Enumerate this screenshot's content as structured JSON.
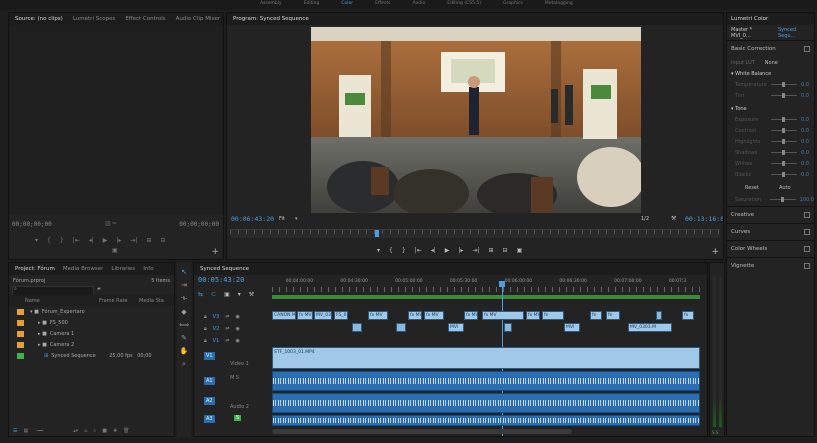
{
  "workspaces": [
    "Assembly",
    "Editing",
    "Color",
    "Effects",
    "Audio",
    "Editing (CS5.5)",
    "Graphics",
    "Metalogging"
  ],
  "source_panel": {
    "tabs": [
      "Source: (no clips)",
      "Lumetri Scopes",
      "Effect Controls",
      "Audio Clip Mixer"
    ],
    "timecode_left": "00;00;00;00",
    "timecode_right": "00;00;00;00"
  },
  "program_panel": {
    "title": "Program: Synced Sequence",
    "timecode": "00:06:43:20",
    "fit": "Fit",
    "fraction": "1/2",
    "duration": "00:13:16:00"
  },
  "lumetri": {
    "title": "Lumetri Color",
    "master": "Master * MVI_0...",
    "sequence": "Synced Sequ...",
    "basic_correction": "Basic Correction",
    "input_lut_label": "Input LUT",
    "input_lut_value": "None",
    "white_balance": "White Balance",
    "temperature": "Temperature",
    "tint": "Tint",
    "tone": "Tone",
    "exposure": "Exposure",
    "contrast": "Contrast",
    "highlights": "Highlights",
    "shadows": "Shadows",
    "whites": "Whites",
    "blacks": "Blacks",
    "value": "0.0",
    "reset": "Reset",
    "auto": "Auto",
    "saturation": "Saturation",
    "saturation_value": "100.0",
    "creative": "Creative",
    "curves": "Curves",
    "color_wheels": "Color Wheels",
    "vignette": "Vignette"
  },
  "project_panel": {
    "tabs": [
      "Project: Fórum",
      "Media Browser",
      "Libraries",
      "Info"
    ],
    "file": "Fórum.prproj",
    "item_count": "5 Items",
    "columns": [
      "Name",
      "Frame Rate",
      "Media Sta"
    ],
    "rows": [
      {
        "name": "Fórum_Expertaro",
        "rate": "",
        "media": "",
        "color": "#e8a032"
      },
      {
        "name": "FS_500",
        "rate": "",
        "media": "",
        "color": "#e8a032"
      },
      {
        "name": "Camera 1",
        "rate": "",
        "media": "",
        "color": "#e8a032"
      },
      {
        "name": "Camera 2",
        "rate": "",
        "media": "",
        "color": "#e8a032"
      },
      {
        "name": "Synced Sequence",
        "rate": "25,00 fps",
        "media": "00;00",
        "color": "#3cb44b"
      }
    ]
  },
  "timeline": {
    "tab": "Synced Sequence",
    "timecode": "00:05:43:20",
    "ruler": [
      "00:04:00:00",
      "00:04:30:00",
      "00:05:00:00",
      "00:05:30:00",
      "00:06:00:00",
      "00:06:30:00",
      "00:07:00:00",
      "00:07:3"
    ],
    "tracks": {
      "v3": "V3",
      "v2": "V2",
      "v1": "V1",
      "video1": "Video 1",
      "a1": "A1",
      "a2": "A2",
      "audio2": "Audio 2",
      "a3": "A3"
    },
    "v1_clip": "STF_1003_01.MP4",
    "v3_clips": [
      "CANON MOV",
      "fx MV_0",
      "MV_03",
      "FS_0",
      "fx MV",
      "fx MV_",
      "fx MV",
      "fx MV_0156.M",
      "fx MV",
      "fx MV",
      "fx",
      "fx",
      "fx",
      "fx"
    ],
    "v2_clips": [
      "MVI",
      "MV_0303.M"
    ]
  },
  "colors": {
    "accent": "#4a9fe0",
    "clip_blue": "#a0c8e8",
    "audio_blue": "#2a6db0",
    "swatch_orange": "#e8a032",
    "swatch_green": "#3cb44b",
    "playhead": "#4a9fe0"
  }
}
